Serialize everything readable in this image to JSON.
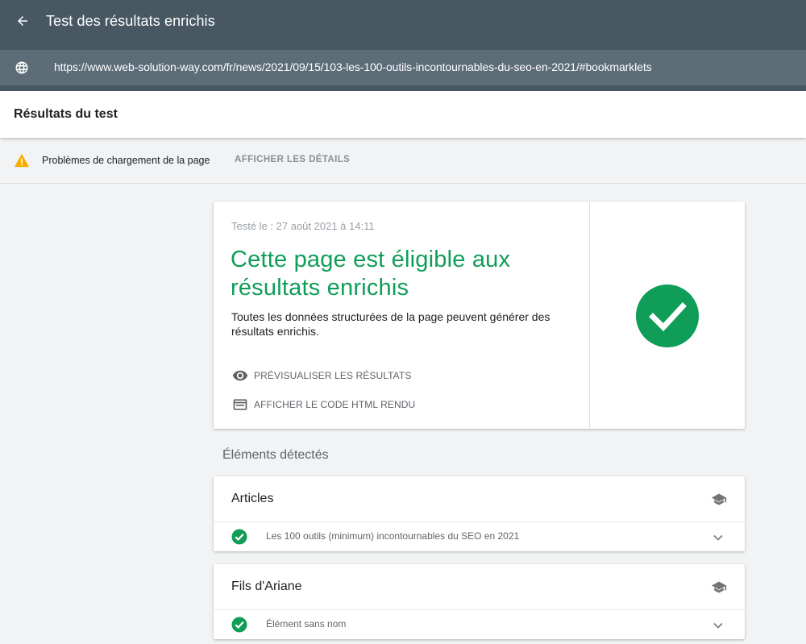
{
  "appbar": {
    "title": "Test des résultats enrichis",
    "url": "https://www.web-solution-way.com/fr/news/2021/09/15/103-les-100-outils-incontournables-du-seo-en-2021/#bookmarklets",
    "bg_color": "#475863",
    "url_bar_color": "#5c6d78"
  },
  "section": {
    "title": "Résultats du test"
  },
  "warning": {
    "text": "Problèmes de chargement de la page",
    "link_label": "AFFICHER LES DÉTAILS",
    "icon": "warning-icon",
    "icon_color": "#f9ab00"
  },
  "result": {
    "tested": "Testé le : 27 août 2021 à 14:11",
    "headline": "Cette page est éligible aux résultats enrichis",
    "description": "Toutes les données structurées de la page peuvent générer des résultats enrichis.",
    "actions": [
      {
        "label": "PRÉVISUALISER LES RÉSULTATS",
        "icon": "eye-icon"
      },
      {
        "label": "AFFICHER LE CODE HTML RENDU",
        "icon": "browser-window-icon"
      }
    ],
    "status_icon": "check-circle-icon",
    "accent_color": "#0f9d58"
  },
  "detected": {
    "title": "Éléments détectés",
    "items": [
      {
        "title": "Articles",
        "rows": [
          {
            "label": "Les 100 outils (minimum) incontournables du SEO en 2021"
          }
        ]
      },
      {
        "title": "Fils d'Ariane",
        "rows": [
          {
            "label": "Élément sans nom"
          }
        ]
      }
    ]
  }
}
